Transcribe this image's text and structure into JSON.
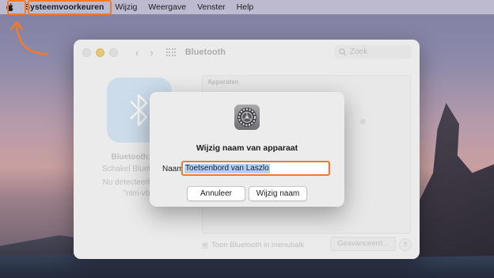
{
  "menubar": {
    "app_menu": "Systeemvoorkeuren",
    "items": [
      "Wijzig",
      "Weergave",
      "Venster",
      "Help"
    ]
  },
  "window": {
    "title": "Bluetooth",
    "search_placeholder": "Zoek",
    "sidebar": {
      "status": "Bluetooth: Aan",
      "toggle": "Schakel Bluetooth uit",
      "discoverable": "Nu detecteerbaar als",
      "device_name": "\"nlm-vbr\""
    },
    "devices_header": "Apparaten",
    "show_in_menubar": "Toon Bluetooth in menubalk",
    "advanced_button": "Geavanceerd...",
    "help_button": "?"
  },
  "sheet": {
    "title": "Wijzig naam van apparaat",
    "name_label": "Naam",
    "name_value": "Toetsenbord van Laszlo",
    "cancel_label": "Annuleer",
    "confirm_label": "Wijzig naam"
  },
  "colors": {
    "highlight": "#f07a2b",
    "selection": "#b3d1f4"
  }
}
